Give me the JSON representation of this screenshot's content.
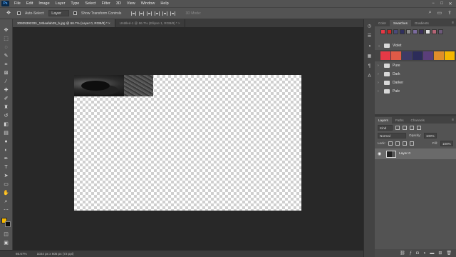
{
  "app": {
    "logo": "Ps"
  },
  "menu": [
    "File",
    "Edit",
    "Image",
    "Layer",
    "Type",
    "Select",
    "Filter",
    "3D",
    "View",
    "Window",
    "Help"
  ],
  "window_controls": [
    "−",
    "□",
    "✕"
  ],
  "options": {
    "auto_select_label": "Auto-Select:",
    "auto_select_value": "Layer",
    "transform_label": "Show Transform Controls",
    "mode3d_label": "3D Mode:"
  },
  "tabs": [
    {
      "label": "30925392331_18baafab39_b.jpg @ 66.7% (Layer 0, RGB/8) *",
      "close": "×"
    },
    {
      "label": "Untitled-1 @ 66.7% (Ellipse 1, RGB/8) *",
      "close": "×"
    }
  ],
  "status": {
    "zoom": "66.67%",
    "doc_info": "1024 px x 605 px (72 ppi)"
  },
  "right_panel": {
    "swatch_tabs": [
      "Color",
      "Swatches",
      "Gradients"
    ],
    "recent_swatches": [
      "#e63946",
      "#c62828",
      "#4a4a7a",
      "#2f2f5e",
      "#8c8c8c",
      "#7b6b9d",
      "#3a2f5a",
      "#e0e0e0",
      "#b56576",
      "#6d597a"
    ],
    "violet_folder": "Violet",
    "violet_swatches": [
      "#e63946",
      "#e05a47",
      "#3e3a66",
      "#2c2c5a",
      "#5a3e7a",
      "#e08e2a",
      "#f5b700"
    ],
    "folders": [
      "Pure",
      "Dark",
      "Darker",
      "Pale"
    ],
    "layer_tabs": [
      "Layers",
      "Paths",
      "Channels"
    ],
    "filter_kind": "Kind",
    "blend_mode": "Normal",
    "opacity_label": "Opacity:",
    "opacity_value": "100%",
    "lock_label": "Lock:",
    "fill_label": "Fill:",
    "fill_value": "100%",
    "layer_name": "Layer 0"
  }
}
